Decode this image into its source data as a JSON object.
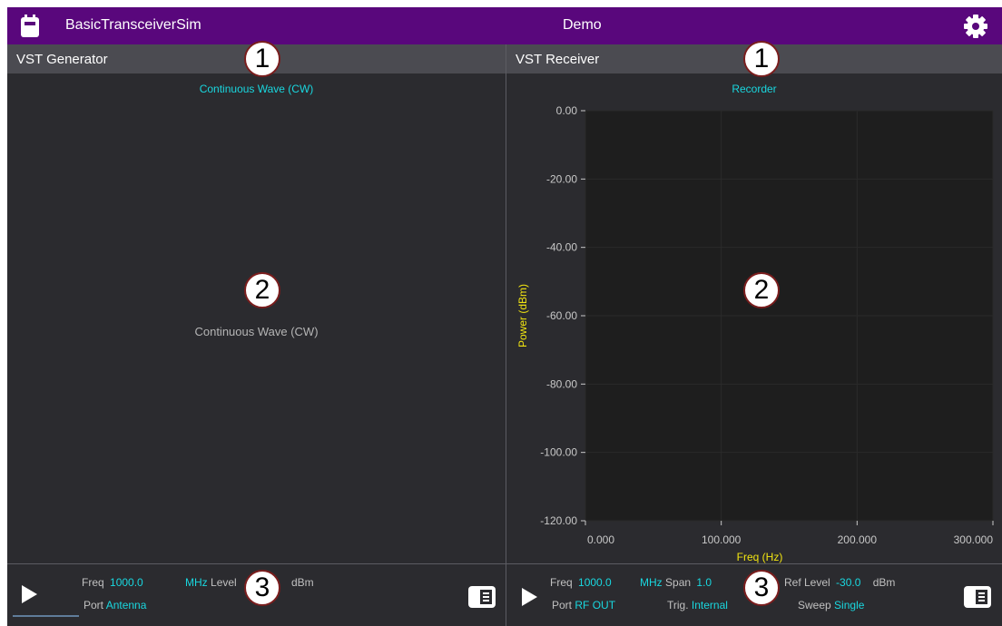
{
  "titlebar": {
    "app_name": "BasicTransceiverSim",
    "mode": "Demo"
  },
  "generator": {
    "header": "VST Generator",
    "mode_link": "Continuous Wave (CW)",
    "content_label": "Continuous Wave (CW)",
    "bar": {
      "freq_label": "Freq",
      "freq_value": "1000.0",
      "freq_unit": "MHz",
      "level_label": "Level",
      "level_unit": "dBm",
      "port_label": "Port",
      "port_value": "Antenna"
    }
  },
  "receiver": {
    "header": "VST Receiver",
    "mode_link": "Recorder",
    "bar": {
      "freq_label": "Freq",
      "freq_value": "1000.0",
      "freq_unit": "MHz",
      "span_label": "Span",
      "span_value": "1.0",
      "ref_label": "Ref Level",
      "ref_value": "-30.0",
      "ref_unit": "dBm",
      "port_label": "Port",
      "port_value": "RF OUT",
      "trig_label": "Trig.",
      "trig_value": "Internal",
      "sweep_label": "Sweep",
      "sweep_value": "Single"
    }
  },
  "callouts": {
    "c1": "1",
    "c2": "2",
    "c3": "3"
  },
  "chart_data": {
    "type": "line",
    "title": "",
    "xlabel": "Freq (Hz)",
    "ylabel": "Power (dBm)",
    "xlim": [
      0,
      300
    ],
    "ylim": [
      -120,
      0
    ],
    "x_ticks": [
      "0.000",
      "100.000",
      "200.000",
      "300.000"
    ],
    "y_ticks": [
      "0.00",
      "-20.00",
      "-40.00",
      "-60.00",
      "-80.00",
      "-100.00",
      "-120.00"
    ],
    "series": [],
    "grid": true
  },
  "colors": {
    "titlebar": "#59077c",
    "accent": "#19d7df",
    "axis_label": "#f2e511",
    "panel_bg": "#2b2b2f",
    "plot_bg": "#1e1e1e"
  },
  "icons": {
    "app": "transceiver-icon",
    "settings": "gear-icon",
    "play": "play-icon",
    "panel": "panel-toggle-icon"
  }
}
